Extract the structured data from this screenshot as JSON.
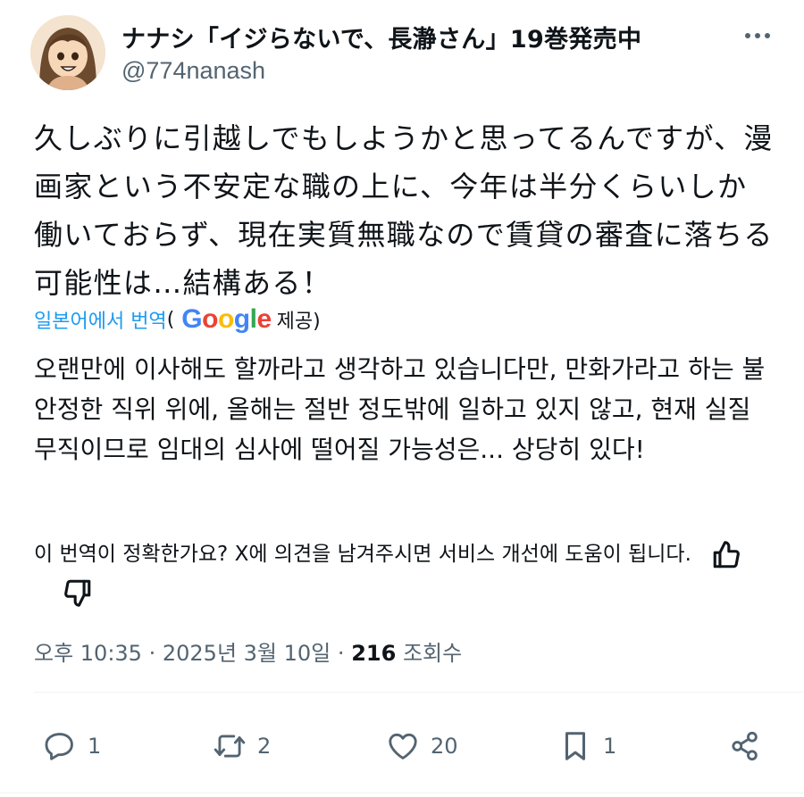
{
  "author": {
    "display_name": "ナナシ「イジらないで、長瀞さん」19巻発売中",
    "handle": "@774nanash",
    "avatar": "avatar-girl-cartoon"
  },
  "tweet": {
    "text": "久しぶりに引越しでもしようかと思ってるんですが、漫画家という不安定な職の上に、今年は半分くらいしか働いておらず、現在実質無職なので賃貸の審査に落ちる可能性は…結構ある！"
  },
  "translation": {
    "label": "일본어에서 번역",
    "open_paren": "(",
    "provider": "Google",
    "provided": "제공)",
    "text": "오랜만에 이사해도 할까라고 생각하고 있습니다만, 만화가라고 하는 불안정한 직위 위에, 올해는 절반 정도밖에 일하고 있지 않고, 현재 실질 무직이므로 임대의 심사에 떨어질 가능성은... 상당히 있다!",
    "feedback": "이 번역이 정확한가요? X에 의견을 남겨주시면 서비스 개선에 도움이 됩니다.",
    "icons": [
      "thumbs-up-icon",
      "thumbs-down-icon"
    ]
  },
  "meta": {
    "time": "오후 10:35",
    "sep1": "·",
    "date": "2025년 3월 10일",
    "sep2": "·",
    "views_count": "216",
    "views_label": "조회수"
  },
  "actions": {
    "reply_count": "1",
    "retweet_count": "2",
    "like_count": "20",
    "bookmark_count": "1"
  },
  "colors": {
    "link": "#1d9bf0",
    "text": "#0f1419",
    "muted": "#536471"
  }
}
